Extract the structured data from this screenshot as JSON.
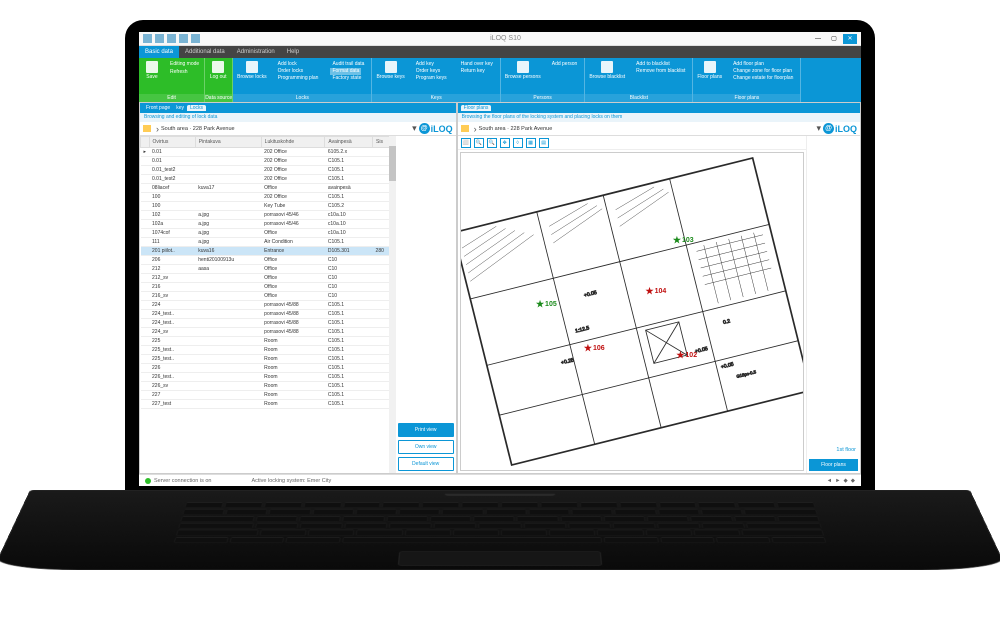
{
  "window": {
    "title": "iLOQ S10"
  },
  "tabs": [
    "Basic data",
    "Additional data",
    "Administration",
    "Help"
  ],
  "ribbon": {
    "edit": {
      "editing": "Editing mode",
      "refresh": "Refresh",
      "save": "Save",
      "label": "Edit"
    },
    "ds": {
      "logout": "Log out",
      "label": "Data source"
    },
    "locks": {
      "browse": "Browse locks",
      "c1": "Add lock",
      "c2": "Order locks",
      "c3": "Programming plan",
      "d1": "Audit trail data",
      "d2": "Format data",
      "d3": "Factory state",
      "label": "Locks"
    },
    "keys": {
      "browse": "Browse keys",
      "c1": "Add key",
      "c2": "Order keys",
      "c3": "Program keys",
      "h1": "Hand over key",
      "h2": "Return key",
      "label": "Keys"
    },
    "persons": {
      "browse": "Browse persons",
      "add": "Add person",
      "label": "Persons"
    },
    "blacklist": {
      "browse": "Browse blacklist",
      "c1": "Add to blacklist",
      "c2": "Remove from blacklist",
      "label": "Blacklist"
    },
    "floor": {
      "browse": "Floor plans",
      "c1": "Add floor plan",
      "c2": "Change zone for floor plan",
      "c3": "Change estate for floorplan",
      "label": "Floor plans"
    }
  },
  "left": {
    "crumbs": [
      "Front page",
      "key",
      "Locks"
    ],
    "subtitle": "Browsing and editing of lock data",
    "path": "South area · 228 Park Avenue",
    "logo": "iLOQ",
    "table": {
      "cols": [
        "Ovirtus",
        "Pintakuva",
        "Lukituskohde",
        "Avainpesä",
        "Sis"
      ],
      "rows": [
        [
          "0.01",
          "",
          "202 Office",
          "6105.2.x",
          ""
        ],
        [
          "0.01",
          "",
          "202 Office",
          "C105.1",
          ""
        ],
        [
          "0.01_test2",
          "",
          "202 Office",
          "C105.1",
          ""
        ],
        [
          "0.01_test2",
          "",
          "202 Office",
          "C105.1",
          ""
        ],
        [
          "08liacef",
          "kuva17",
          "Office",
          "avainpesä",
          ""
        ],
        [
          "100",
          "",
          "202 Office",
          "C105.1",
          ""
        ],
        [
          "100",
          "",
          "Key Tube",
          "C105.2",
          ""
        ],
        [
          "102",
          "a.jpg",
          "porrasovi 45/46",
          "c10a.10",
          ""
        ],
        [
          "102a",
          "a.jpg",
          "porrasovi 45/46",
          "c10a.10",
          ""
        ],
        [
          "1074cof",
          "a.jpg",
          "Office",
          "c10a.10",
          ""
        ],
        [
          "111",
          "a.jpg",
          "Air Condition",
          "C105.1",
          ""
        ],
        [
          "201 piilot..",
          "kuva16",
          "Entrance",
          "D105.301",
          "280"
        ],
        [
          "206",
          "henti20100913u",
          "Office",
          "C10",
          ""
        ],
        [
          "212",
          "aasa",
          "Office",
          "C10",
          ""
        ],
        [
          "212_sv",
          "",
          "Office",
          "C10",
          ""
        ],
        [
          "216",
          "",
          "Office",
          "C10",
          ""
        ],
        [
          "216_sv",
          "",
          "Office",
          "C10",
          ""
        ],
        [
          "224",
          "",
          "porrasovi 45/88",
          "C105.1",
          ""
        ],
        [
          "224_test..",
          "",
          "porrasovi 45/88",
          "C105.1",
          ""
        ],
        [
          "224_test..",
          "",
          "porrasovi 45/88",
          "C105.1",
          ""
        ],
        [
          "224_sv",
          "",
          "porrasovi 45/88",
          "C105.1",
          ""
        ],
        [
          "225",
          "",
          "Room",
          "C105.1",
          ""
        ],
        [
          "225_test..",
          "",
          "Room",
          "C105.1",
          ""
        ],
        [
          "225_test..",
          "",
          "Room",
          "C105.1",
          ""
        ],
        [
          "226",
          "",
          "Room",
          "C105.1",
          ""
        ],
        [
          "226_test..",
          "",
          "Room",
          "C105.1",
          ""
        ],
        [
          "226_sv",
          "",
          "Room",
          "C105.1",
          ""
        ],
        [
          "227",
          "",
          "Room",
          "C105.1",
          ""
        ],
        [
          "227_test",
          "",
          "Room",
          "C105.1",
          ""
        ]
      ]
    },
    "buttons": {
      "print": "Print view",
      "own": "Own view",
      "default": "Default view"
    }
  },
  "right": {
    "crumb": "Floor plans",
    "subtitle": "Browsing the floor plans of the locking system and placing locks on them",
    "path": "South area · 228 Park Avenue",
    "logo": "iLOQ",
    "markers": [
      {
        "id": "103",
        "color": "green",
        "x": 62,
        "y": 26
      },
      {
        "id": "104",
        "color": "red",
        "x": 54,
        "y": 42
      },
      {
        "id": "105",
        "color": "green",
        "x": 22,
        "y": 46
      },
      {
        "id": "106",
        "color": "red",
        "x": 36,
        "y": 60
      },
      {
        "id": "102",
        "color": "red",
        "x": 63,
        "y": 62
      }
    ],
    "level": "1st floor",
    "planbtn": "Floor plans"
  },
  "status": {
    "conn": "Server connection is on",
    "sys": "Active locking system: Emer City"
  }
}
